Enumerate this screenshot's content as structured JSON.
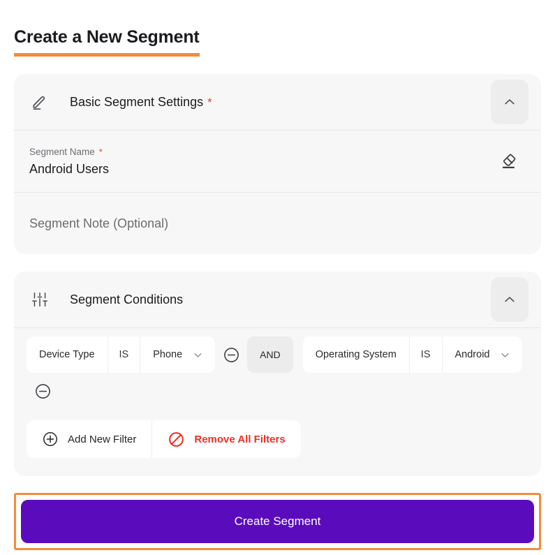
{
  "page": {
    "title": "Create a New Segment",
    "accent_orange": "#f58a3c",
    "accent_purple": "#5a0cbd",
    "danger_red": "#ee3124",
    "required_star": "*"
  },
  "basic_settings": {
    "icon": "pencil-edit-icon",
    "title": "Basic Segment Settings",
    "required_marker": "*",
    "collapse_icon": "chevron-up-icon",
    "segment_name": {
      "label": "Segment Name",
      "required_marker": "*",
      "value": "Android Users",
      "clear_icon": "eraser-icon"
    },
    "segment_note": {
      "placeholder": "Segment Note (Optional)",
      "value": ""
    }
  },
  "segment_conditions": {
    "icon": "sliders-filter-icon",
    "title": "Segment Conditions",
    "collapse_icon": "chevron-up-icon",
    "joiner": "AND",
    "filters": [
      {
        "attribute": "Device Type",
        "operator": "IS",
        "value": "Phone",
        "dropdown_icon": "chevron-down-icon",
        "remove_icon": "minus-circle-icon"
      },
      {
        "attribute": "Operating System",
        "operator": "IS",
        "value": "Android",
        "dropdown_icon": "chevron-down-icon",
        "remove_icon": "minus-circle-icon"
      }
    ],
    "actions": {
      "add_label": "Add New Filter",
      "add_icon": "plus-circle-icon",
      "remove_all_label": "Remove All Filters",
      "remove_all_icon": "ban-prohibition-icon"
    }
  },
  "submit": {
    "label": "Create Segment"
  }
}
